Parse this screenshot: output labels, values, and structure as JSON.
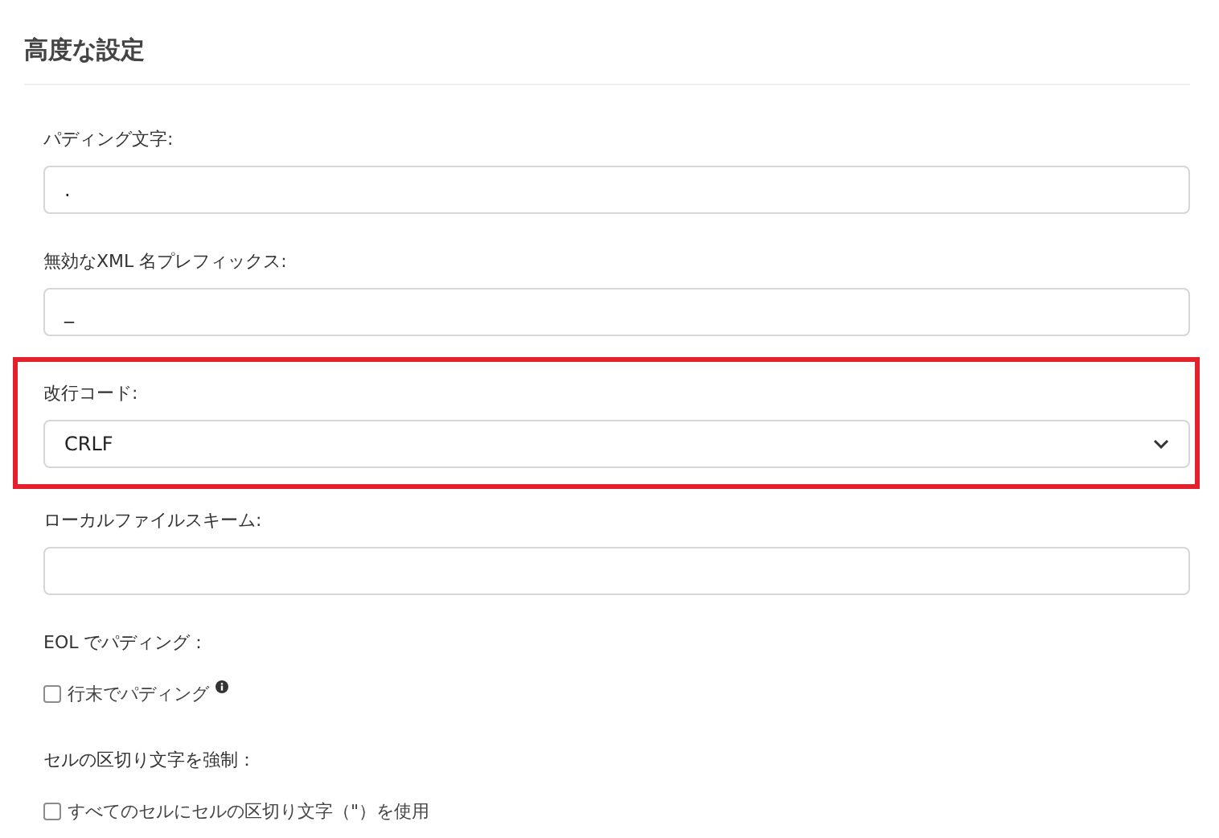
{
  "section": {
    "title": "高度な設定"
  },
  "fields": [
    {
      "kind": "text",
      "label": "パディング文字:",
      "value": ".",
      "highlighted": false
    },
    {
      "kind": "text",
      "label": "無効なXML 名プレフィックス:",
      "value": "_",
      "highlighted": false
    },
    {
      "kind": "select",
      "label": "改行コード:",
      "value": "CRLF",
      "highlighted": true
    },
    {
      "kind": "text",
      "label": "ローカルファイルスキーム:",
      "highlighted": false
    },
    {
      "kind": "checkbox",
      "label": "EOL でパディング：",
      "option": "行末でパディング",
      "checked": false,
      "info": true,
      "highlighted": false
    },
    {
      "kind": "checkbox",
      "label": "セルの区切り文字を強制：",
      "option": "すべてのセルにセルの区切り文字（\"）を使用",
      "checked": false,
      "info": false,
      "highlighted": false
    }
  ]
}
